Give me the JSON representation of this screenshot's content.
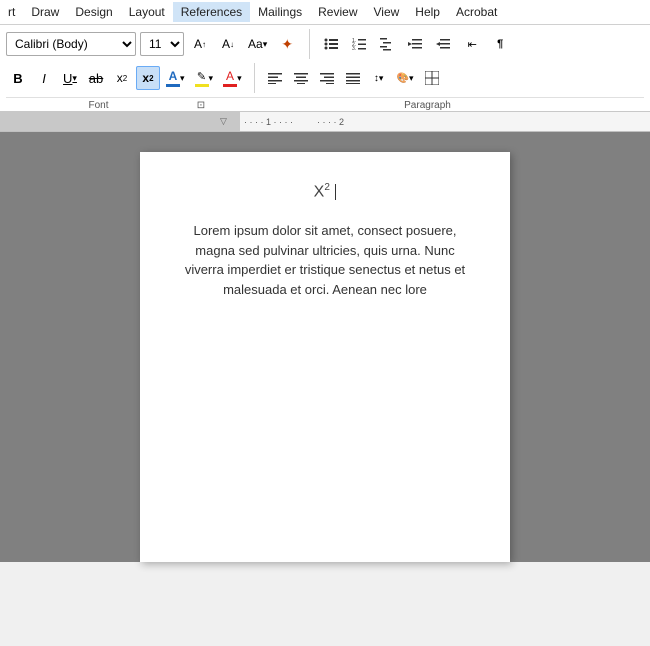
{
  "menubar": {
    "items": [
      {
        "label": "rt",
        "id": "menu-rt"
      },
      {
        "label": "Draw",
        "id": "menu-draw"
      },
      {
        "label": "Design",
        "id": "menu-design"
      },
      {
        "label": "Layout",
        "id": "menu-layout"
      },
      {
        "label": "References",
        "id": "menu-references"
      },
      {
        "label": "Mailings",
        "id": "menu-mailings"
      },
      {
        "label": "Review",
        "id": "menu-review"
      },
      {
        "label": "View",
        "id": "menu-view"
      },
      {
        "label": "Help",
        "id": "menu-help"
      },
      {
        "label": "Acrobat",
        "id": "menu-acrobat"
      }
    ]
  },
  "ribbon": {
    "font_name": "Calibri (Body)",
    "font_size": "11",
    "font_name_placeholder": "Calibri (Body)",
    "font_size_placeholder": "11",
    "buttons_row1": [
      {
        "label": "A↑",
        "name": "increase-font-btn"
      },
      {
        "label": "A↓",
        "name": "decrease-font-btn"
      },
      {
        "label": "Aa▾",
        "name": "change-case-btn"
      },
      {
        "label": "✦",
        "name": "clear-format-btn"
      }
    ],
    "buttons_row2_font": [
      {
        "label": "B",
        "name": "bold-btn",
        "class": "btn-bold"
      },
      {
        "label": "I",
        "name": "italic-btn",
        "class": "btn-italic"
      },
      {
        "label": "U",
        "name": "underline-btn",
        "class": "btn-underline"
      },
      {
        "label": "ab",
        "name": "strikethrough-btn",
        "class": "btn-strike"
      },
      {
        "label": "x₂",
        "name": "subscript-btn"
      },
      {
        "label": "x²",
        "name": "superscript-btn"
      }
    ],
    "labels": {
      "font": "Font",
      "paragraph": "Paragraph"
    }
  },
  "document": {
    "x2_label": "X",
    "x2_sup": "2",
    "lorem_text": "Lorem ipsum dolor sit amet, consect posuere, magna sed pulvinar ultricies, quis urna. Nunc viverra imperdiet er tristique senectus et netus et malesuada et orci. Aenean nec lore"
  },
  "arrow": {
    "color": "#00cc00",
    "points_to": "superscript-btn"
  }
}
